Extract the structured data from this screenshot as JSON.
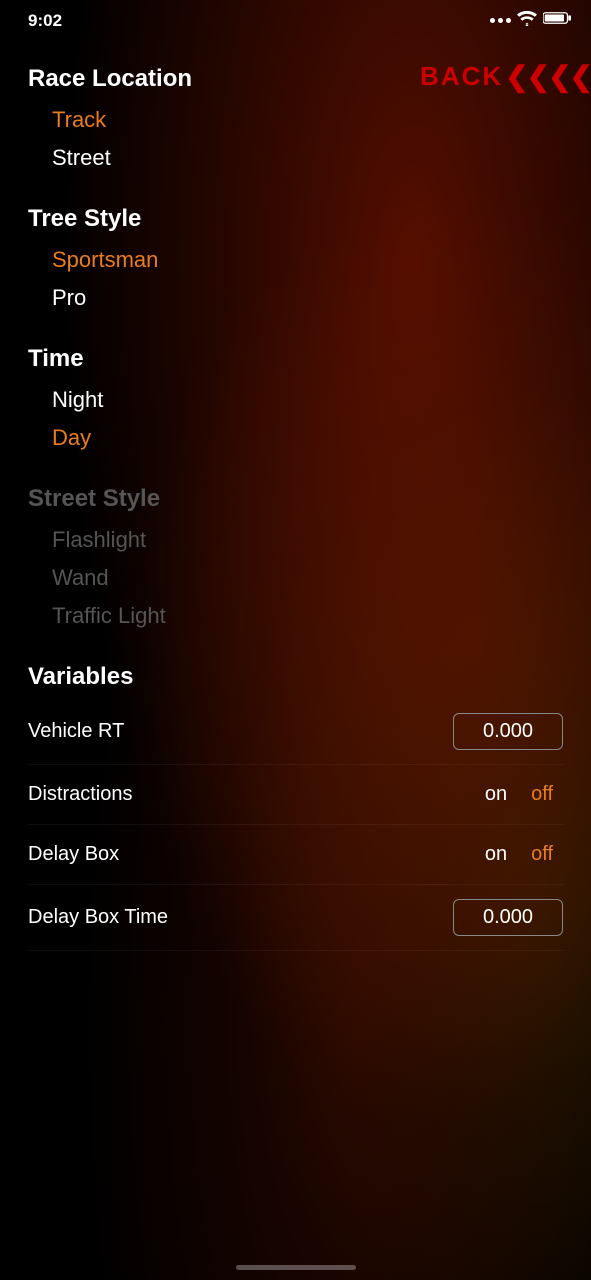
{
  "statusBar": {
    "time": "9:02",
    "wifiIcon": "wifi-icon",
    "batteryIcon": "battery-icon"
  },
  "backButton": {
    "label": "BACK",
    "arrows": "<<<<<"
  },
  "sections": {
    "raceLocation": {
      "heading": "Race Location",
      "items": [
        {
          "label": "Track",
          "state": "selected"
        },
        {
          "label": "Street",
          "state": "normal"
        }
      ]
    },
    "treeStyle": {
      "heading": "Tree Style",
      "items": [
        {
          "label": "Sportsman",
          "state": "selected"
        },
        {
          "label": "Pro",
          "state": "normal"
        }
      ]
    },
    "time": {
      "heading": "Time",
      "items": [
        {
          "label": "Night",
          "state": "normal"
        },
        {
          "label": "Day",
          "state": "selected"
        }
      ]
    },
    "streetStyle": {
      "heading": "Street Style",
      "items": [
        {
          "label": "Flashlight",
          "state": "dimmed"
        },
        {
          "label": "Wand",
          "state": "dimmed"
        },
        {
          "label": "Traffic Light",
          "state": "dimmed"
        }
      ]
    },
    "variables": {
      "heading": "Variables",
      "rows": [
        {
          "label": "Vehicle RT",
          "type": "input",
          "value": "0.000"
        },
        {
          "label": "Distractions",
          "type": "toggle",
          "options": [
            "on",
            "off"
          ],
          "active": "off"
        },
        {
          "label": "Delay Box",
          "type": "toggle",
          "options": [
            "on",
            "off"
          ],
          "active": "off"
        },
        {
          "label": "Delay Box Time",
          "type": "input",
          "value": "0.000"
        }
      ]
    }
  }
}
